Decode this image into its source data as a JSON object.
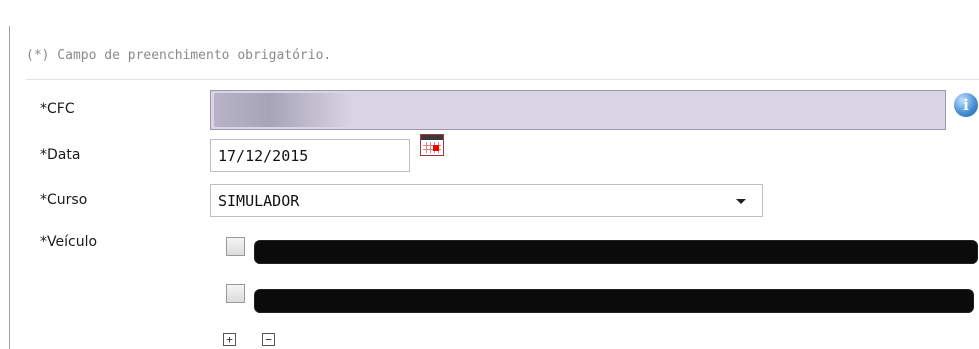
{
  "form": {
    "required_note": "(*) Campo de preenchimento obrigatório.",
    "fields": {
      "cfc_label": "*CFC",
      "data_label": "*Data",
      "data_value": "17/12/2015",
      "curso_label": "*Curso",
      "curso_value": "SIMULADOR",
      "veiculo_label": "*Veículo"
    },
    "info_icon": "i",
    "add_symbol": "+",
    "remove_symbol": "−"
  },
  "icons": [
    "info-icon",
    "calendar-icon",
    "chevron-down-icon",
    "plus-icon",
    "minus-icon"
  ],
  "colors": {
    "cfc_field_bg": "#d9d4e6",
    "calendar_accent": "#e00000",
    "info_blue": "#4a90d6"
  }
}
